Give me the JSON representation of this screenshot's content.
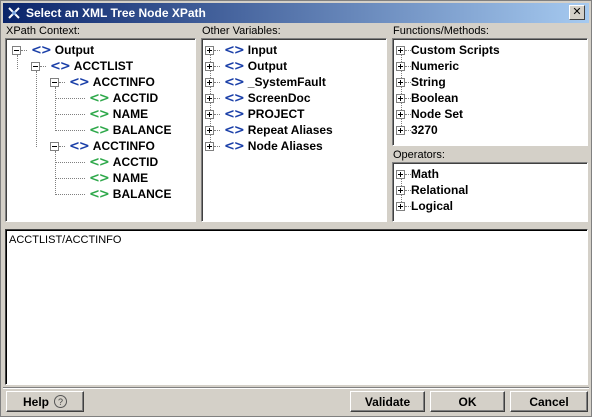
{
  "window": {
    "title": "Select an XML Tree Node XPath",
    "close_label": "✕"
  },
  "xpath_context": {
    "label": "XPath Context:",
    "nodes": [
      "Output",
      "ACCTLIST",
      "ACCTINFO",
      "ACCTID",
      "NAME",
      "BALANCE",
      "ACCTINFO",
      "ACCTID",
      "NAME",
      "BALANCE"
    ]
  },
  "other_variables": {
    "label": "Other Variables:",
    "items": [
      "Input",
      "Output",
      "_SystemFault",
      "ScreenDoc",
      "PROJECT",
      "Repeat Aliases",
      "Node Aliases"
    ]
  },
  "functions": {
    "label": "Functions/Methods:",
    "items": [
      "Custom Scripts",
      "Numeric",
      "String",
      "Boolean",
      "Node Set",
      "3270"
    ]
  },
  "operators": {
    "label": "Operators:",
    "items": [
      "Math",
      "Relational",
      "Logical"
    ]
  },
  "xpath": {
    "value": "ACCTLIST/ACCTINFO"
  },
  "buttons": {
    "help": "Help",
    "help_glyph": "?",
    "validate": "Validate",
    "ok": "OK",
    "cancel": "Cancel"
  },
  "colors": {
    "tag_blue": "#1a3fa8",
    "tag_green": "#2ea84a",
    "title_start": "#0a246a",
    "title_end": "#a6caf0"
  }
}
